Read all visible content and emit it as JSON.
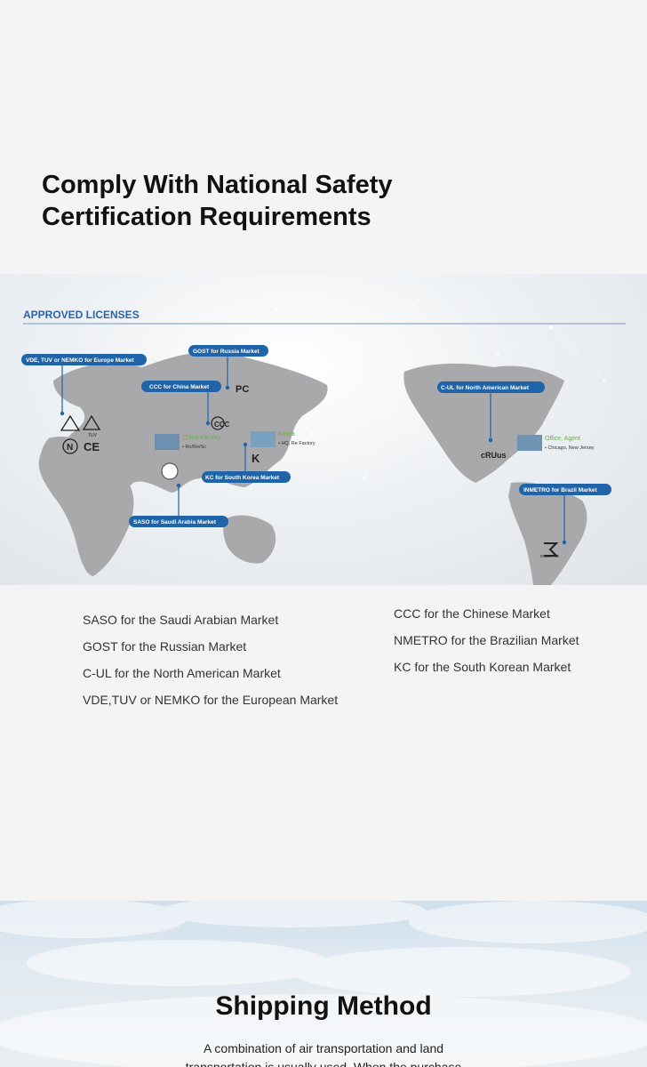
{
  "page_title": "Comply With National Safety\nCertification Requirements",
  "map": {
    "heading": "APPROVED LICENSES",
    "tags": {
      "europe": "VDE, TUV or NEMKO for Europe Market",
      "russia": "GOST for Russia Market",
      "china": "CCC for China Market",
      "korea": "KC for South Korea Market",
      "saudi": "SASO for Saudi Arabia Market",
      "north_america": "C-UL for North American Market",
      "brazil": "INMETRO for Brazil Market"
    },
    "sites": {
      "china_name": "China Factory",
      "china_detail": "• Ro/Re/Sc",
      "korea_name": "Korea",
      "korea_detail": "• HQ, Re Factory",
      "us_name": "Office, Agent",
      "us_detail": "• Chicago, New Jersey"
    },
    "marks": {
      "tuv": "TUV",
      "n": "N",
      "ce": "CE",
      "pc": "PC",
      "ccc": "CCC",
      "kc": "K",
      "ul": "cRUus",
      "inmetro": "INMETRO"
    }
  },
  "licenses_left": [
    "SASO for the Saudi Arabian Market",
    "GOST for the Russian Market",
    "C-UL for the North American Market",
    "VDE,TUV or NEMKO for the European Market"
  ],
  "licenses_right": [
    "CCC for the Chinese Market",
    "NMETRO for the Brazilian Market",
    "KC for the South Korean Market"
  ],
  "shipping": {
    "title": "Shipping Method",
    "text": "A combination of air transportation and land transportation is usually used. When the purchase"
  },
  "colors": {
    "tag_blue": "#1f63a8",
    "heading_blue": "#2a64ad",
    "site_green": "#6aa84f"
  }
}
